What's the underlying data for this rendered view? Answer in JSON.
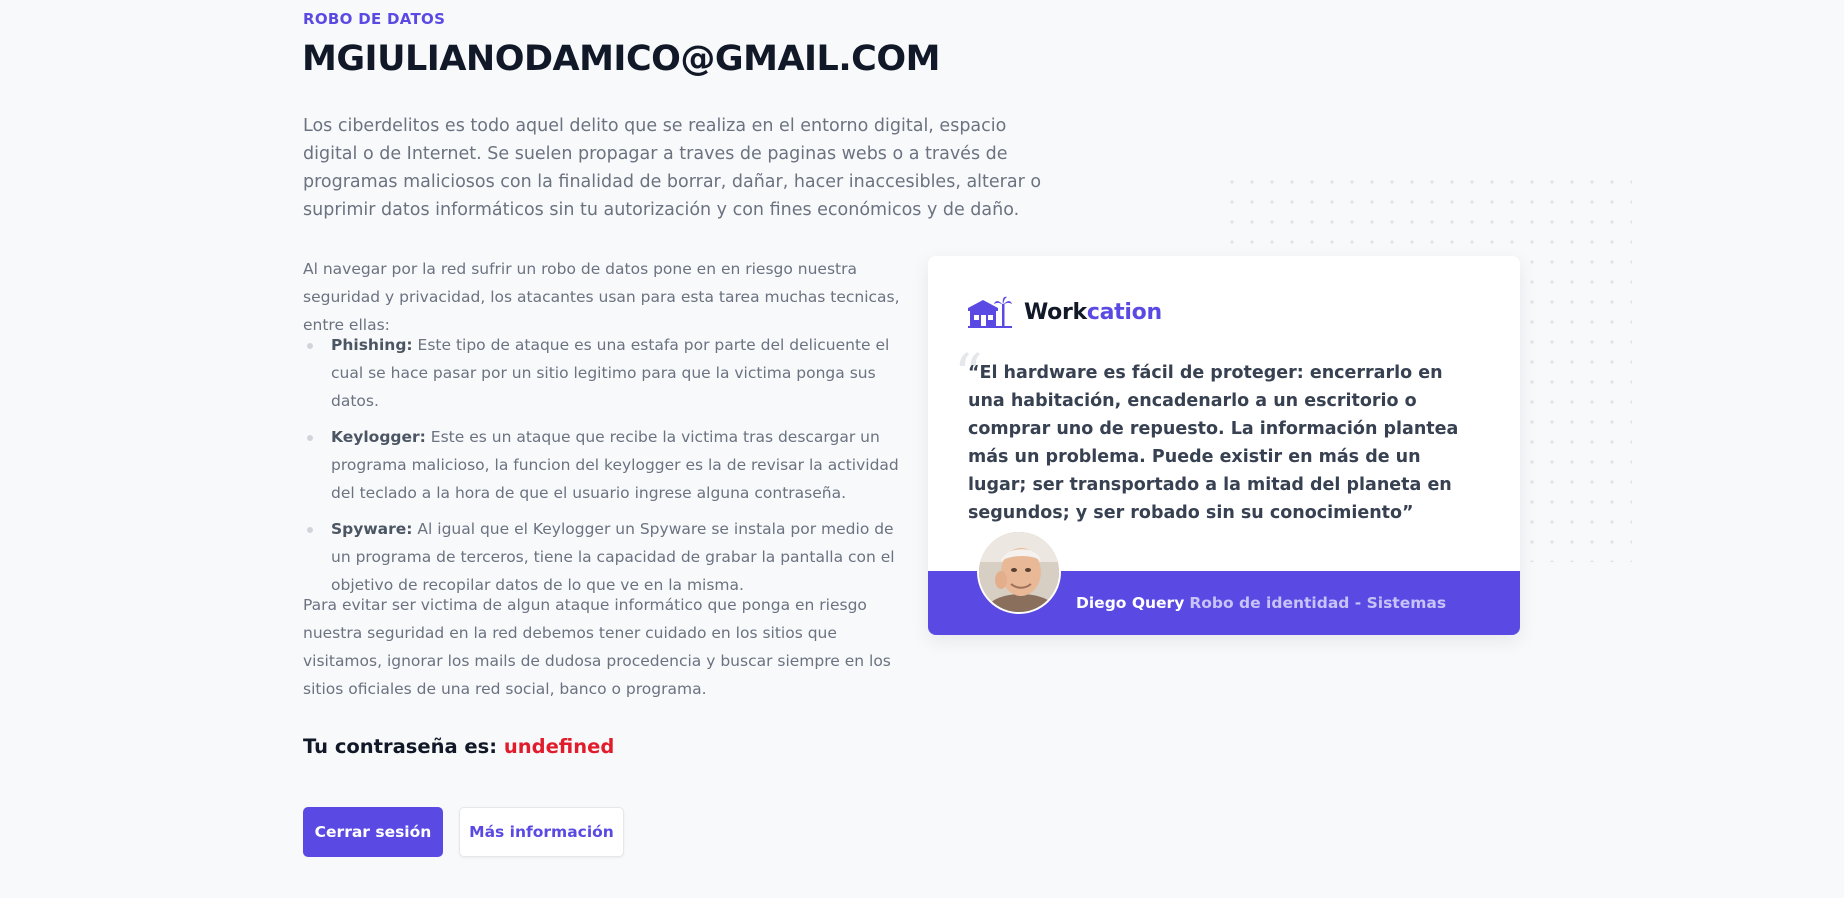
{
  "header": {
    "eyebrow": "ROBO DE DATOS",
    "title": "MGIULIANODAMICO@GMAIL.COM"
  },
  "intro": "Los ciberdelitos es todo aquel delito que se realiza en el entorno digital, espacio digital o de Internet. Se suelen propagar a traves de paginas webs o a través de programas maliciosos con la finalidad de borrar, dañar, hacer inaccesibles, alterar o suprimir datos informáticos sin tu autorización y con fines económicos y de daño.",
  "paragraph1": "Al navegar por la red sufrir un robo de datos pone en en riesgo nuestra seguridad y privacidad, los atacantes usan para esta tarea muchas tecnicas, entre ellas:",
  "attacks": [
    {
      "term": "Phishing:",
      "description": " Este tipo de ataque es una estafa por parte del delicuente el cual se hace pasar por un sitio legitimo para que la victima ponga sus datos."
    },
    {
      "term": "Keylogger:",
      "description": " Este es un ataque que recibe la victima tras descargar un programa malicioso, la funcion del keylogger es la de revisar la actividad del teclado a la hora de que el usuario ingrese alguna contraseña."
    },
    {
      "term": "Spyware:",
      "description": " Al igual que el Keylogger un Spyware se instala por medio de un programa de terceros, tiene la capacidad de grabar la pantalla con el objetivo de recopilar datos de lo que ve en la misma."
    }
  ],
  "paragraph2": "Para evitar ser victima de algun ataque informático que ponga en riesgo nuestra seguridad en la red debemos tener cuidado en los sitios que visitamos, ignorar los mails de dudosa procedencia y buscar siempre en los sitios oficiales de una red social, banco o programa.",
  "password": {
    "label": "Tu contraseña es: ",
    "value": "undefined"
  },
  "buttons": {
    "logout": "Cerrar sesión",
    "more_info": "Más información"
  },
  "card": {
    "brand_part1": "Work",
    "brand_part2": "cation",
    "quote_mark": "“",
    "quote": "El hardware es fácil de proteger: encerrarlo en una habitación, encadenarlo a un escritorio o comprar uno de repuesto. La información plantea más un problema. Puede existir en más de un lugar; ser transportado a la mitad del planeta en segundos; y ser robado sin su conocimiento”",
    "author_name": "Diego Query",
    "author_role": "Robo de identidad - Sistemas"
  },
  "colors": {
    "accent": "#5a4ae3",
    "danger": "#e11d2c",
    "heading": "#111827",
    "body": "#6b7280"
  },
  "icons": [
    "workcation-logo-icon",
    "quote-icon",
    "avatar"
  ]
}
